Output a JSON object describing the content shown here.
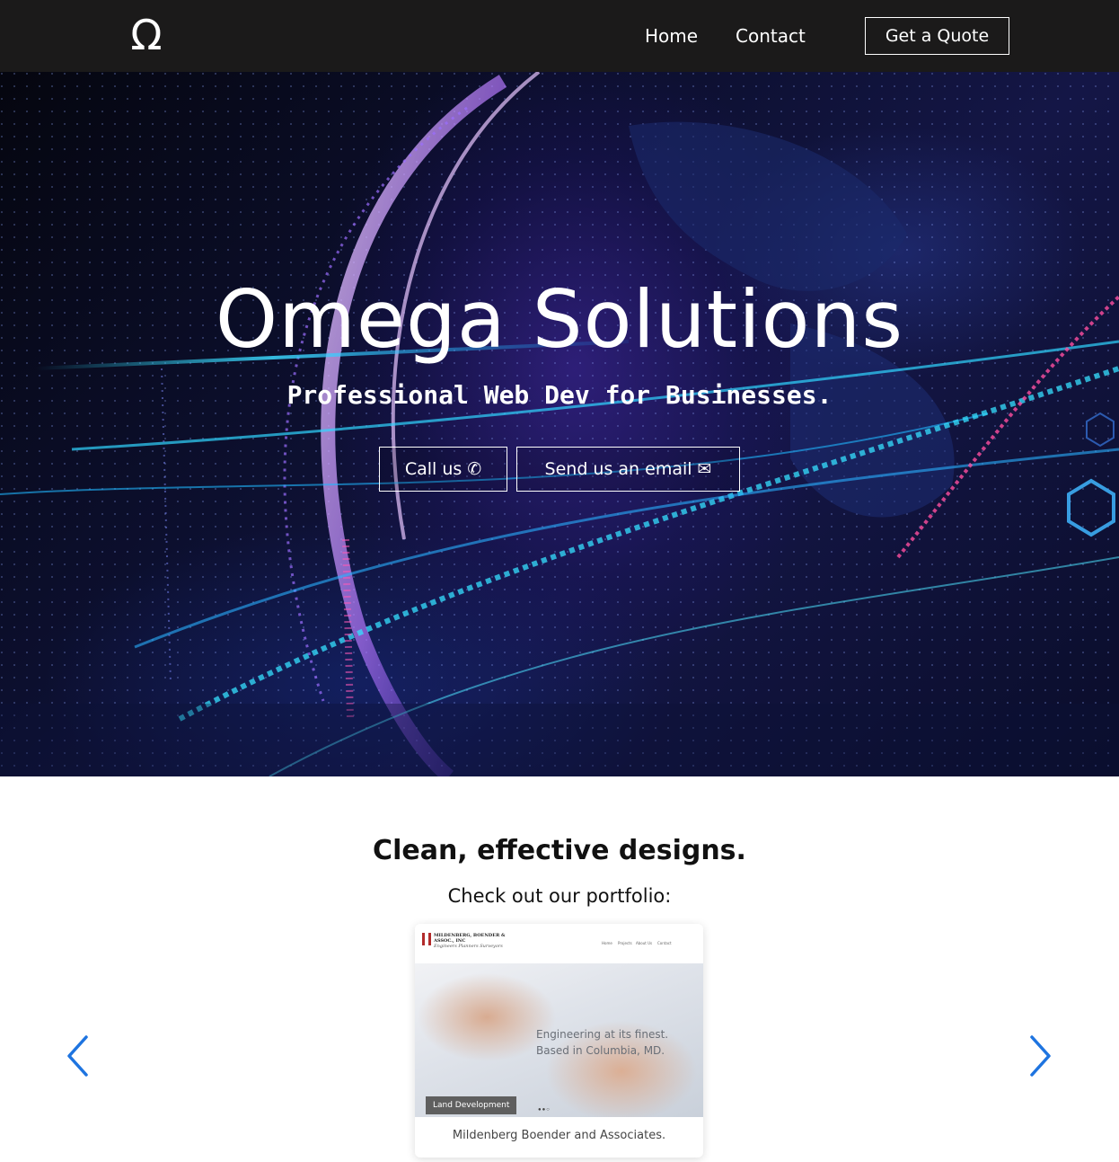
{
  "navbar": {
    "logo_glyph": "Ω",
    "logo_icon": "omega-logo-icon",
    "links": [
      {
        "label": "Home"
      },
      {
        "label": "Contact"
      }
    ],
    "quote_button": "Get a Quote"
  },
  "hero": {
    "title": "Omega Solutions",
    "subtitle": "Professional Web Dev for Businesses.",
    "buttons": {
      "call": {
        "label": "Call us",
        "icon": "phone-icon"
      },
      "email": {
        "label": "Send us an email",
        "icon": "envelope-icon"
      }
    }
  },
  "portfolio": {
    "heading": "Clean, effective designs.",
    "subheading": "Check out our portfolio:",
    "prev_icon": "chevron-left-icon",
    "next_icon": "chevron-right-icon",
    "card": {
      "screenshot": {
        "logo_text": "MILDENBERG, BOENDER & ASSOC., INC",
        "logo_subtext": "Engineers   Planners   Surveyors",
        "nav": [
          "Home",
          "Projects",
          "About Us",
          "Contact"
        ],
        "tagline_line1": "Engineering at its finest.",
        "tagline_line2": "Based in Columbia, MD.",
        "badge": "Land Development"
      },
      "caption": "Mildenberg Boender and Associates."
    }
  },
  "colors": {
    "navbar_bg": "#1b1a1a",
    "accent_arrow": "#1e74e0",
    "text_dark": "#111111"
  }
}
